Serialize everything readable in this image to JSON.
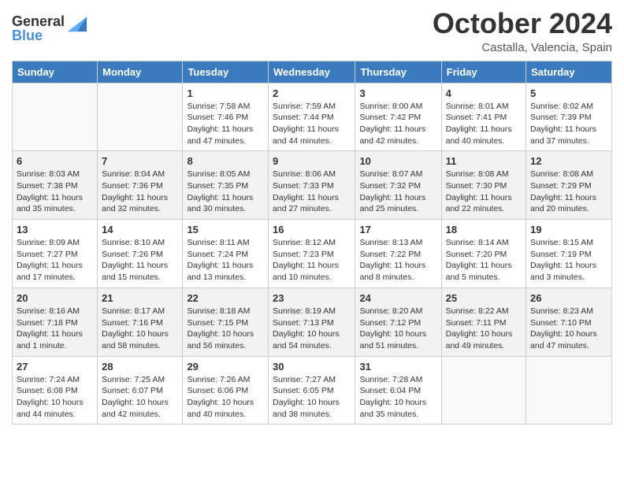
{
  "header": {
    "logo_general": "General",
    "logo_blue": "Blue",
    "month_title": "October 2024",
    "location": "Castalla, Valencia, Spain"
  },
  "weekdays": [
    "Sunday",
    "Monday",
    "Tuesday",
    "Wednesday",
    "Thursday",
    "Friday",
    "Saturday"
  ],
  "weeks": [
    [
      {
        "day": "",
        "info": ""
      },
      {
        "day": "",
        "info": ""
      },
      {
        "day": "1",
        "info": "Sunrise: 7:58 AM\nSunset: 7:46 PM\nDaylight: 11 hours and 47 minutes."
      },
      {
        "day": "2",
        "info": "Sunrise: 7:59 AM\nSunset: 7:44 PM\nDaylight: 11 hours and 44 minutes."
      },
      {
        "day": "3",
        "info": "Sunrise: 8:00 AM\nSunset: 7:42 PM\nDaylight: 11 hours and 42 minutes."
      },
      {
        "day": "4",
        "info": "Sunrise: 8:01 AM\nSunset: 7:41 PM\nDaylight: 11 hours and 40 minutes."
      },
      {
        "day": "5",
        "info": "Sunrise: 8:02 AM\nSunset: 7:39 PM\nDaylight: 11 hours and 37 minutes."
      }
    ],
    [
      {
        "day": "6",
        "info": "Sunrise: 8:03 AM\nSunset: 7:38 PM\nDaylight: 11 hours and 35 minutes."
      },
      {
        "day": "7",
        "info": "Sunrise: 8:04 AM\nSunset: 7:36 PM\nDaylight: 11 hours and 32 minutes."
      },
      {
        "day": "8",
        "info": "Sunrise: 8:05 AM\nSunset: 7:35 PM\nDaylight: 11 hours and 30 minutes."
      },
      {
        "day": "9",
        "info": "Sunrise: 8:06 AM\nSunset: 7:33 PM\nDaylight: 11 hours and 27 minutes."
      },
      {
        "day": "10",
        "info": "Sunrise: 8:07 AM\nSunset: 7:32 PM\nDaylight: 11 hours and 25 minutes."
      },
      {
        "day": "11",
        "info": "Sunrise: 8:08 AM\nSunset: 7:30 PM\nDaylight: 11 hours and 22 minutes."
      },
      {
        "day": "12",
        "info": "Sunrise: 8:08 AM\nSunset: 7:29 PM\nDaylight: 11 hours and 20 minutes."
      }
    ],
    [
      {
        "day": "13",
        "info": "Sunrise: 8:09 AM\nSunset: 7:27 PM\nDaylight: 11 hours and 17 minutes."
      },
      {
        "day": "14",
        "info": "Sunrise: 8:10 AM\nSunset: 7:26 PM\nDaylight: 11 hours and 15 minutes."
      },
      {
        "day": "15",
        "info": "Sunrise: 8:11 AM\nSunset: 7:24 PM\nDaylight: 11 hours and 13 minutes."
      },
      {
        "day": "16",
        "info": "Sunrise: 8:12 AM\nSunset: 7:23 PM\nDaylight: 11 hours and 10 minutes."
      },
      {
        "day": "17",
        "info": "Sunrise: 8:13 AM\nSunset: 7:22 PM\nDaylight: 11 hours and 8 minutes."
      },
      {
        "day": "18",
        "info": "Sunrise: 8:14 AM\nSunset: 7:20 PM\nDaylight: 11 hours and 5 minutes."
      },
      {
        "day": "19",
        "info": "Sunrise: 8:15 AM\nSunset: 7:19 PM\nDaylight: 11 hours and 3 minutes."
      }
    ],
    [
      {
        "day": "20",
        "info": "Sunrise: 8:16 AM\nSunset: 7:18 PM\nDaylight: 11 hours and 1 minute."
      },
      {
        "day": "21",
        "info": "Sunrise: 8:17 AM\nSunset: 7:16 PM\nDaylight: 10 hours and 58 minutes."
      },
      {
        "day": "22",
        "info": "Sunrise: 8:18 AM\nSunset: 7:15 PM\nDaylight: 10 hours and 56 minutes."
      },
      {
        "day": "23",
        "info": "Sunrise: 8:19 AM\nSunset: 7:13 PM\nDaylight: 10 hours and 54 minutes."
      },
      {
        "day": "24",
        "info": "Sunrise: 8:20 AM\nSunset: 7:12 PM\nDaylight: 10 hours and 51 minutes."
      },
      {
        "day": "25",
        "info": "Sunrise: 8:22 AM\nSunset: 7:11 PM\nDaylight: 10 hours and 49 minutes."
      },
      {
        "day": "26",
        "info": "Sunrise: 8:23 AM\nSunset: 7:10 PM\nDaylight: 10 hours and 47 minutes."
      }
    ],
    [
      {
        "day": "27",
        "info": "Sunrise: 7:24 AM\nSunset: 6:08 PM\nDaylight: 10 hours and 44 minutes."
      },
      {
        "day": "28",
        "info": "Sunrise: 7:25 AM\nSunset: 6:07 PM\nDaylight: 10 hours and 42 minutes."
      },
      {
        "day": "29",
        "info": "Sunrise: 7:26 AM\nSunset: 6:06 PM\nDaylight: 10 hours and 40 minutes."
      },
      {
        "day": "30",
        "info": "Sunrise: 7:27 AM\nSunset: 6:05 PM\nDaylight: 10 hours and 38 minutes."
      },
      {
        "day": "31",
        "info": "Sunrise: 7:28 AM\nSunset: 6:04 PM\nDaylight: 10 hours and 35 minutes."
      },
      {
        "day": "",
        "info": ""
      },
      {
        "day": "",
        "info": ""
      }
    ]
  ]
}
